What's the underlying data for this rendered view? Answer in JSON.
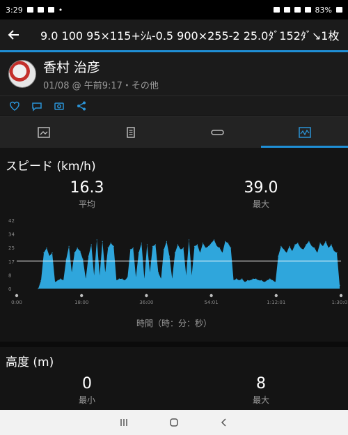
{
  "status": {
    "time": "3:29",
    "battery": "83%"
  },
  "appbar": {
    "title": "9.0 100 95×115+ｼﾑ-0.5 900×255-2 25.0ﾀﾞ152ﾀﾞ↘1枚"
  },
  "profile": {
    "name": "香村 治彦",
    "meta": "01/08 @ 午前9:17・その他"
  },
  "speed": {
    "title": "スピード (km/h)",
    "avg_value": "16.3",
    "avg_label": "平均",
    "max_value": "39.0",
    "max_label": "最大"
  },
  "chart_data": {
    "type": "area",
    "color": "#2fa6dc",
    "avg_line": 17,
    "ylim": [
      0,
      42
    ],
    "yticks": [
      "42",
      "34",
      "25",
      "17",
      "8",
      "0"
    ],
    "xticks": [
      "0:00",
      "18:00",
      "36:00",
      "54:01",
      "1:12:01",
      "1:30:01"
    ],
    "xlabel": "時間（時：分：秒）",
    "x_max_min": 90,
    "values": [
      0,
      5,
      22,
      25,
      20,
      22,
      4,
      5,
      6,
      5,
      18,
      26,
      10,
      22,
      25,
      23,
      18,
      6,
      20,
      27,
      8,
      30,
      8,
      29,
      10,
      25,
      28,
      26,
      5,
      6,
      6,
      5,
      7,
      24,
      25,
      7,
      22,
      28,
      6,
      27,
      10,
      26,
      27,
      10,
      6,
      24,
      29,
      20,
      6,
      22,
      27,
      24,
      25,
      8,
      30,
      8,
      26,
      27,
      22,
      28,
      25,
      26,
      28,
      30,
      26,
      25,
      22,
      29,
      28,
      25,
      5,
      6,
      5,
      6,
      4,
      5,
      5,
      6,
      6,
      5,
      5,
      4,
      5,
      6,
      5,
      4,
      20,
      26,
      24,
      22,
      26,
      23,
      27,
      28,
      25,
      24,
      27,
      29,
      26,
      25,
      22,
      28,
      26,
      29,
      25,
      27,
      23,
      22,
      2
    ]
  },
  "altitude": {
    "title": "高度 (m)",
    "min_value": "0",
    "min_label": "最小",
    "max_value": "8",
    "max_label": "最大"
  }
}
